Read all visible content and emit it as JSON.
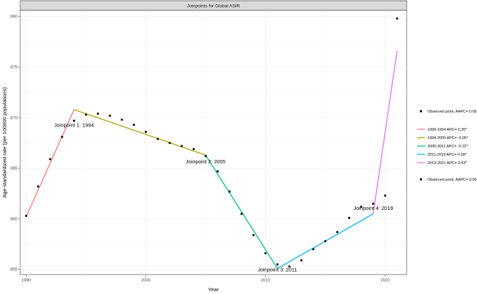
{
  "chart_data": {
    "type": "line",
    "title": "Joinpoints for Global ASIR",
    "xlabel": "Year",
    "ylabel": "Age-standardized rate (per 100000 populations)",
    "xlim": [
      1989.5,
      2021.8
    ],
    "ylim": [
      854.5,
      880.6
    ],
    "x_ticks": [
      1990,
      2000,
      2010,
      2020
    ],
    "y_ticks": [
      855,
      860,
      865,
      870,
      875,
      880
    ],
    "grid": true,
    "observed": {
      "name": "Observed point, AAPC= 0.06",
      "x": [
        1990,
        1991,
        1992,
        1993,
        1994,
        1995,
        1996,
        1997,
        1998,
        1999,
        2000,
        2001,
        2002,
        2003,
        2004,
        2005,
        2006,
        2007,
        2008,
        2009,
        2010,
        2011,
        2012,
        2013,
        2014,
        2015,
        2016,
        2017,
        2018,
        2019,
        2020,
        2021
      ],
      "y": [
        860.3,
        863.2,
        865.9,
        868.1,
        869.7,
        870.3,
        870.4,
        870.2,
        869.8,
        869.3,
        868.6,
        867.9,
        867.5,
        867.2,
        866.9,
        866.2,
        864.7,
        862.7,
        860.5,
        858.4,
        856.6,
        855.5,
        855.3,
        855.9,
        857.0,
        857.8,
        858.7,
        860.1,
        861.2,
        861.5,
        862.3,
        879.8
      ]
    },
    "series": [
      {
        "name": "1990-1994 APC= 0.30*",
        "color": "#F8766D",
        "x": [
          1990,
          1994
        ],
        "y": [
          860.2,
          870.8
        ]
      },
      {
        "name": "1994-2005 APC= -0.05*",
        "color": "#A3A500",
        "x": [
          1994,
          2005
        ],
        "y": [
          870.8,
          866.3
        ]
      },
      {
        "name": "2005-2011 APC= -0.22*",
        "color": "#00BF7D",
        "x": [
          2005,
          2011
        ],
        "y": [
          866.3,
          855.1
        ]
      },
      {
        "name": "2011-2019 APC= 0.08*",
        "color": "#00B0F6",
        "x": [
          2011,
          2019
        ],
        "y": [
          855.1,
          860.5
        ]
      },
      {
        "name": "2019-2021 APC= 0.93*",
        "color": "#E76BF3",
        "x": [
          2019,
          2021
        ],
        "y": [
          860.5,
          876.6
        ]
      }
    ],
    "annotations": [
      {
        "text": "Joinpoint 1: 1994",
        "x": 1994,
        "y": 869.3
      },
      {
        "text": "Joinpoint 2: 2005",
        "x": 2005,
        "y": 865.7
      },
      {
        "text": "Joinpoint 3: 2011",
        "x": 2011,
        "y": 855.0
      },
      {
        "text": "Joinpoint 4: 2019",
        "x": 2019,
        "y": 861.1
      }
    ],
    "legend": {
      "placement": "right",
      "top_entry": "Observed point, AAPC= 0.06",
      "bottom_entry": "Observed point, AAPC= 0.06"
    }
  }
}
